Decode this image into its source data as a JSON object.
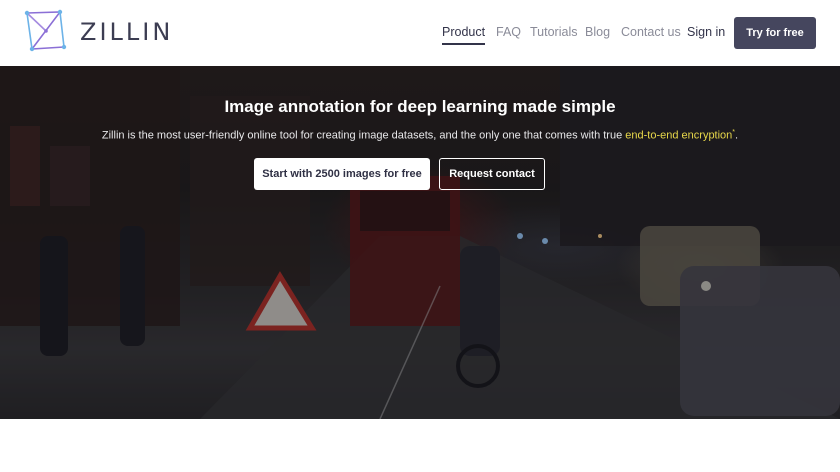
{
  "brand": {
    "name": "ZILLIN"
  },
  "nav": {
    "items": [
      {
        "label": "Product",
        "active": true
      },
      {
        "label": "FAQ"
      },
      {
        "label": "Tutorials"
      },
      {
        "label": "Blog"
      },
      {
        "label": "Contact us"
      }
    ],
    "sign_in": "Sign in",
    "try_button": "Try for free"
  },
  "hero": {
    "title": "Image annotation for deep learning made simple",
    "subtitle_prefix": "Zillin is the most user-friendly online tool for creating image datasets, and the only one that comes with true ",
    "subtitle_highlight": "end-to-end encryption",
    "subtitle_star": "*",
    "subtitle_suffix": ".",
    "primary_button": "Start with 2500 images for free",
    "secondary_button": "Request contact"
  },
  "colors": {
    "brand_dark": "#45465e",
    "highlight": "#e8d84a",
    "logo_accent": "#8b6fd6"
  }
}
